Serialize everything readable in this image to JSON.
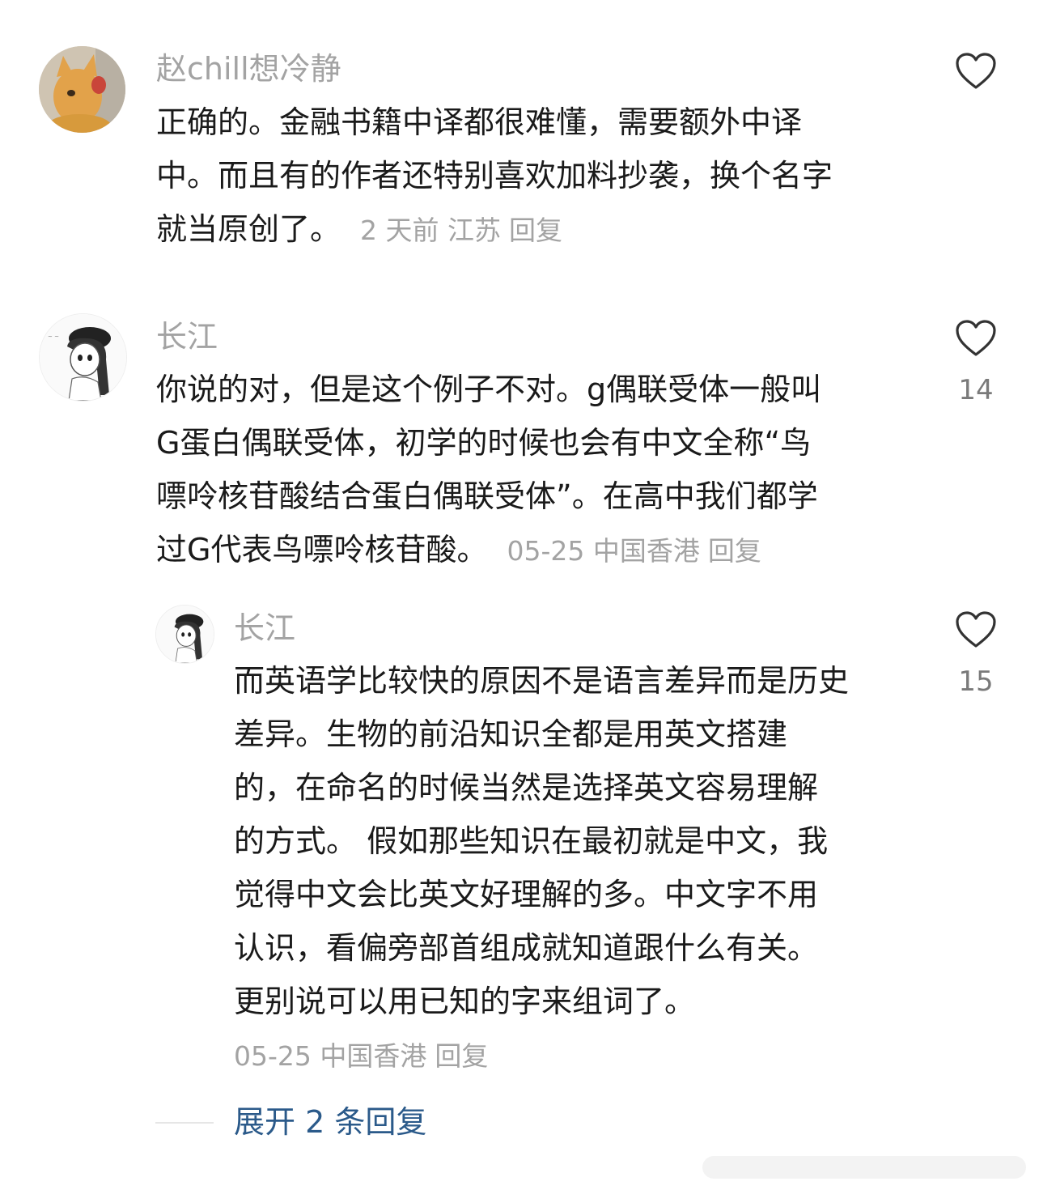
{
  "comments": [
    {
      "username": "赵chill想冷静",
      "lines": [
        "正确的。金融书籍中译都很难懂，需要额外中译",
        "中。而且有的作者还特别喜欢加料抄袭，换个名字",
        "就当原创了。"
      ],
      "time": "2 天前",
      "location": "江苏",
      "reply_label": "回复",
      "likes": ""
    },
    {
      "username": "长江",
      "lines": [
        "你说的对，但是这个例子不对。g偶联受体一般叫",
        "G蛋白偶联受体，初学的时候也会有中文全称“鸟",
        "嘌呤核苷酸结合蛋白偶联受体”。在高中我们都学",
        "过G代表鸟嘌呤核苷酸。"
      ],
      "time": "05-25",
      "location": "中国香港",
      "reply_label": "回复",
      "likes": "14"
    }
  ],
  "reply": {
    "username": "长江",
    "lines": [
      "而英语学比较快的原因不是语言差异而是历史",
      "差异。生物的前沿知识全都是用英文搭建",
      "的，在命名的时候当然是选择英文容易理解",
      "的方式。 假如那些知识在最初就是中文，我",
      "觉得中文会比英文好理解的多。中文字不用",
      "认识，看偏旁部首组成就知道跟什么有关。",
      "更别说可以用已知的字来组词了。"
    ],
    "time": "05-25",
    "location": "中国香港",
    "reply_label": "回复",
    "likes": "15"
  },
  "expand_label": "展开 2 条回复",
  "icons": {
    "like": "heart-outline-icon"
  },
  "colors": {
    "username": "#a3a3a3",
    "text": "#1a1a1a",
    "link": "#2b5a8a"
  }
}
